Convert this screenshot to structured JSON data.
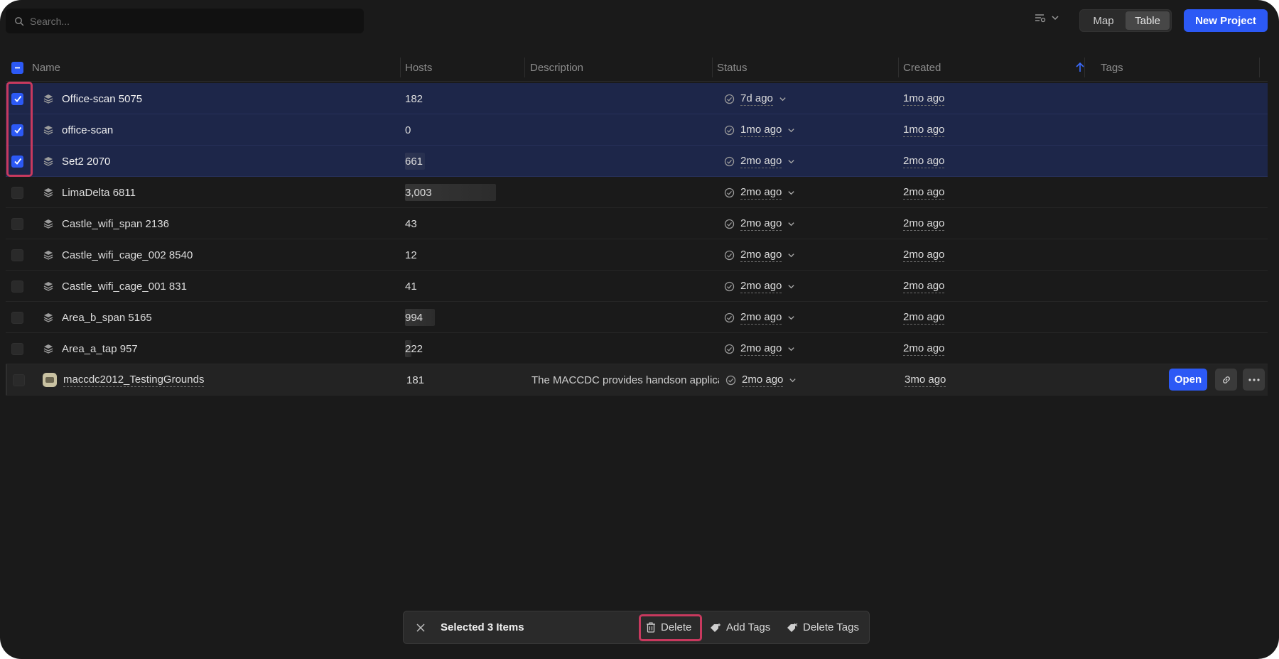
{
  "search": {
    "placeholder": "Search..."
  },
  "view_toggle": {
    "map": "Map",
    "table": "Table",
    "active": "Table"
  },
  "new_project_label": "New Project",
  "columns": {
    "name": "Name",
    "hosts": "Hosts",
    "description": "Description",
    "status": "Status",
    "created": "Created",
    "tags": "Tags"
  },
  "sort": {
    "column": "Created",
    "direction": "ascending"
  },
  "rows": [
    {
      "name": "Office-scan 5075",
      "hosts": "182",
      "host_share": 0.0,
      "description": "",
      "status": "7d ago",
      "created": "1mo ago",
      "selected": true,
      "icon": "layers-icon"
    },
    {
      "name": "office-scan",
      "hosts": "0",
      "host_share": 0.0,
      "description": "",
      "status": "1mo ago",
      "created": "1mo ago",
      "selected": true,
      "icon": "layers-icon"
    },
    {
      "name": "Set2 2070",
      "hosts": "661",
      "host_share": 0.22,
      "description": "",
      "status": "2mo ago",
      "created": "2mo ago",
      "selected": true,
      "icon": "layers-icon"
    },
    {
      "name": "LimaDelta 6811",
      "hosts": "3,003",
      "host_share": 1.0,
      "description": "",
      "status": "2mo ago",
      "created": "2mo ago",
      "selected": false,
      "icon": "layers-icon"
    },
    {
      "name": "Castle_wifi_span 2136",
      "hosts": "43",
      "host_share": 0.0,
      "description": "",
      "status": "2mo ago",
      "created": "2mo ago",
      "selected": false,
      "icon": "layers-icon"
    },
    {
      "name": "Castle_wifi_cage_002 8540",
      "hosts": "12",
      "host_share": 0.0,
      "description": "",
      "status": "2mo ago",
      "created": "2mo ago",
      "selected": false,
      "icon": "layers-icon"
    },
    {
      "name": "Castle_wifi_cage_001 831",
      "hosts": "41",
      "host_share": 0.0,
      "description": "",
      "status": "2mo ago",
      "created": "2mo ago",
      "selected": false,
      "icon": "layers-icon"
    },
    {
      "name": "Area_b_span 5165",
      "hosts": "994",
      "host_share": 0.33,
      "description": "",
      "status": "2mo ago",
      "created": "2mo ago",
      "selected": false,
      "icon": "layers-icon"
    },
    {
      "name": "Area_a_tap 957",
      "hosts": "222",
      "host_share": 0.07,
      "description": "",
      "status": "2mo ago",
      "created": "2mo ago",
      "selected": false,
      "icon": "layers-icon"
    },
    {
      "name": "maccdc2012_TestingGrounds",
      "hosts": "181",
      "host_share": 0.0,
      "description": "The MACCDC provides handson applicat",
      "status": "2mo ago",
      "created": "3mo ago",
      "selected": false,
      "icon": "project-thumbnail-icon"
    }
  ],
  "hover_row_actions": {
    "open": "Open",
    "link_icon": "link-icon",
    "more_icon": "more-horizontal-icon"
  },
  "action_bar": {
    "title": "Selected 3 Items",
    "delete": "Delete",
    "add_tags": "Add Tags",
    "delete_tags": "Delete Tags"
  },
  "colors": {
    "accent": "#2c59f5",
    "highlight": "#c8395e",
    "selected_row": "#1d2649",
    "background": "#1a1a1a"
  }
}
